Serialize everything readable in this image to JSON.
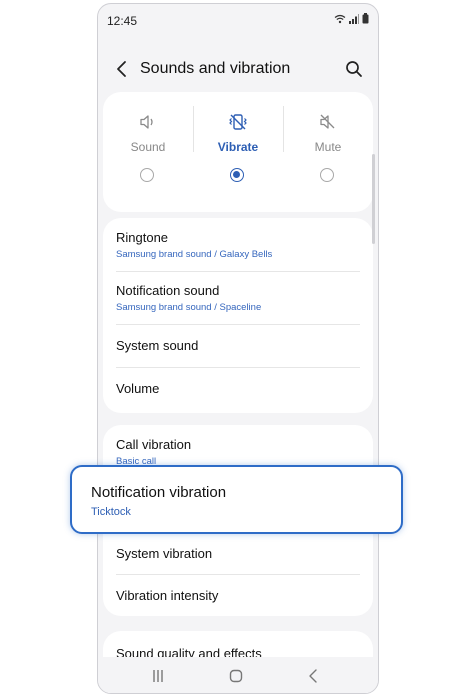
{
  "status_bar": {
    "time": "12:45"
  },
  "header": {
    "title": "Sounds and vibration"
  },
  "sound_modes": {
    "options": [
      {
        "label": "Sound",
        "icon": "speaker-icon"
      },
      {
        "label": "Vibrate",
        "icon": "vibrate-icon"
      },
      {
        "label": "Mute",
        "icon": "mute-icon"
      }
    ],
    "selected": "Vibrate"
  },
  "settings_group_1": [
    {
      "title": "Ringtone",
      "subtitle": "Samsung brand sound / Galaxy Bells"
    },
    {
      "title": "Notification sound",
      "subtitle": "Samsung brand sound / Spaceline"
    },
    {
      "title": "System sound"
    },
    {
      "title": "Volume"
    }
  ],
  "settings_group_2": [
    {
      "title": "Call vibration",
      "subtitle": "Basic call"
    },
    {
      "title": "Notification vibration",
      "subtitle": "Ticktock"
    },
    {
      "title": "System vibration"
    },
    {
      "title": "Vibration intensity"
    }
  ],
  "settings_group_3": [
    {
      "title": "Sound quality and effects"
    }
  ],
  "colors": {
    "accent": "#2e5fb4",
    "highlight_border": "#2e6cc7",
    "background": "#f4f4f6"
  }
}
